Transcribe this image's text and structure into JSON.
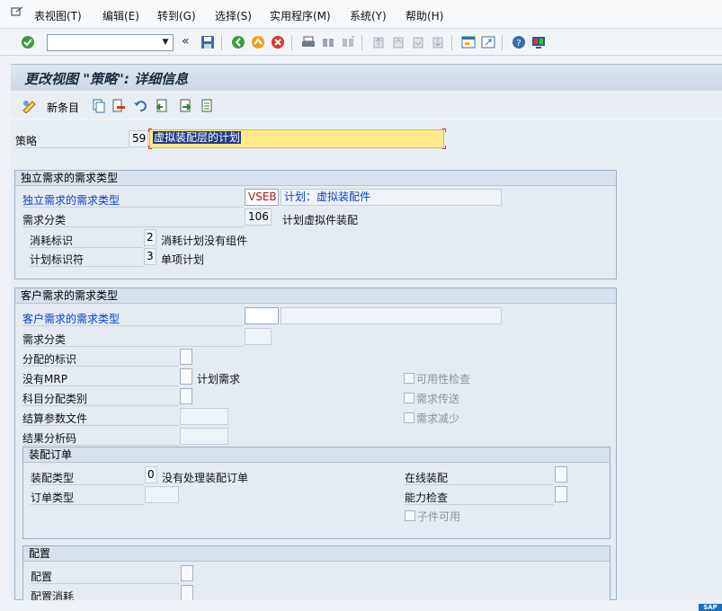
{
  "menu": {
    "items": [
      {
        "label": "表视图(T)"
      },
      {
        "label": "编辑(E)"
      },
      {
        "label": "转到(G)"
      },
      {
        "label": "选择(S)"
      },
      {
        "label": "实用程序(M)"
      },
      {
        "label": "系统(Y)"
      },
      {
        "label": "帮助(H)"
      }
    ]
  },
  "toolbar": {
    "command_value": "",
    "back_symbol": "«"
  },
  "title": "更改视图 \"策略\": 详细信息",
  "app_toolbar": {
    "new_entries_label": "新条目"
  },
  "strategy": {
    "label": "策略",
    "code": "59",
    "description": "虚拟装配层的计划"
  },
  "independent": {
    "title": "独立需求的需求类型",
    "req_type_label": "独立需求的需求类型",
    "req_type_value": "VSEB",
    "req_type_text": "计划：虚拟装配件",
    "req_class_label": "需求分类",
    "req_class_value": "106",
    "req_class_text": "计划虚拟件装配",
    "consumption_label": "消耗标识",
    "consumption_value": "2",
    "consumption_text": "消耗计划没有组件",
    "planning_label": "计划标识符",
    "planning_value": "3",
    "planning_text": "单项计划"
  },
  "customer": {
    "title": "客户需求的需求类型",
    "req_type_label": "客户需求的需求类型",
    "req_class_label": "需求分类",
    "allocation_label": "分配的标识",
    "no_mrp_label": "没有MRP",
    "no_mrp_text": "计划需求",
    "acct_assign_label": "科目分配类别",
    "settlement_label": "结算参数文件",
    "results_analysis_label": "结果分析码",
    "availability_check": "可用性检查",
    "req_transfer": "需求传送",
    "req_reduction": "需求减少"
  },
  "assembly": {
    "title": "装配订单",
    "asm_type_label": "装配类型",
    "asm_type_value": "0",
    "asm_type_text": "没有处理装配订单",
    "order_type_label": "订单类型",
    "online_asm_label": "在线装配",
    "capacity_check_label": "能力检查",
    "component_avail": "子件可用"
  },
  "config": {
    "title": "配置",
    "config_label": "配置",
    "config_consumption_label": "配置消耗"
  },
  "colors": {
    "accent_blue": "#0b3ed1",
    "highlight_yellow": "#ffe98a",
    "selection_blue": "#1f3d8a"
  },
  "status": {
    "logo_text": "SAP"
  }
}
